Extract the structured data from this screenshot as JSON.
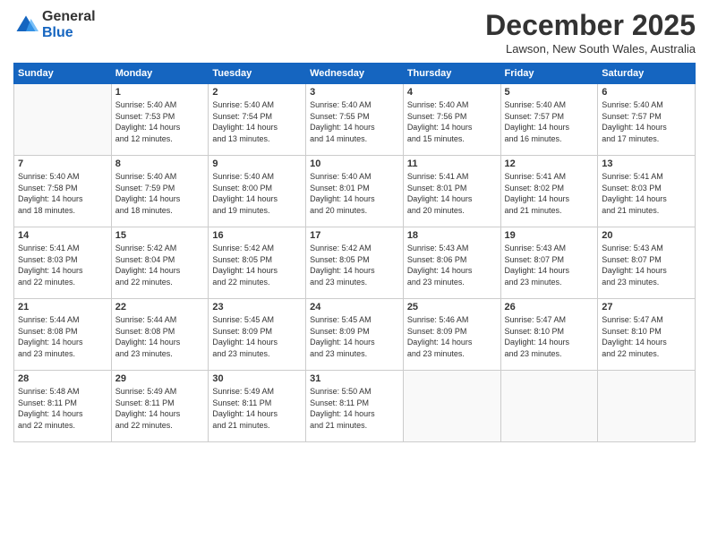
{
  "logo": {
    "general": "General",
    "blue": "Blue"
  },
  "title": "December 2025",
  "subtitle": "Lawson, New South Wales, Australia",
  "weekdays": [
    "Sunday",
    "Monday",
    "Tuesday",
    "Wednesday",
    "Thursday",
    "Friday",
    "Saturday"
  ],
  "weeks": [
    [
      {
        "day": "",
        "info": ""
      },
      {
        "day": "1",
        "info": "Sunrise: 5:40 AM\nSunset: 7:53 PM\nDaylight: 14 hours\nand 12 minutes."
      },
      {
        "day": "2",
        "info": "Sunrise: 5:40 AM\nSunset: 7:54 PM\nDaylight: 14 hours\nand 13 minutes."
      },
      {
        "day": "3",
        "info": "Sunrise: 5:40 AM\nSunset: 7:55 PM\nDaylight: 14 hours\nand 14 minutes."
      },
      {
        "day": "4",
        "info": "Sunrise: 5:40 AM\nSunset: 7:56 PM\nDaylight: 14 hours\nand 15 minutes."
      },
      {
        "day": "5",
        "info": "Sunrise: 5:40 AM\nSunset: 7:57 PM\nDaylight: 14 hours\nand 16 minutes."
      },
      {
        "day": "6",
        "info": "Sunrise: 5:40 AM\nSunset: 7:57 PM\nDaylight: 14 hours\nand 17 minutes."
      }
    ],
    [
      {
        "day": "7",
        "info": "Sunrise: 5:40 AM\nSunset: 7:58 PM\nDaylight: 14 hours\nand 18 minutes."
      },
      {
        "day": "8",
        "info": "Sunrise: 5:40 AM\nSunset: 7:59 PM\nDaylight: 14 hours\nand 18 minutes."
      },
      {
        "day": "9",
        "info": "Sunrise: 5:40 AM\nSunset: 8:00 PM\nDaylight: 14 hours\nand 19 minutes."
      },
      {
        "day": "10",
        "info": "Sunrise: 5:40 AM\nSunset: 8:01 PM\nDaylight: 14 hours\nand 20 minutes."
      },
      {
        "day": "11",
        "info": "Sunrise: 5:41 AM\nSunset: 8:01 PM\nDaylight: 14 hours\nand 20 minutes."
      },
      {
        "day": "12",
        "info": "Sunrise: 5:41 AM\nSunset: 8:02 PM\nDaylight: 14 hours\nand 21 minutes."
      },
      {
        "day": "13",
        "info": "Sunrise: 5:41 AM\nSunset: 8:03 PM\nDaylight: 14 hours\nand 21 minutes."
      }
    ],
    [
      {
        "day": "14",
        "info": "Sunrise: 5:41 AM\nSunset: 8:03 PM\nDaylight: 14 hours\nand 22 minutes."
      },
      {
        "day": "15",
        "info": "Sunrise: 5:42 AM\nSunset: 8:04 PM\nDaylight: 14 hours\nand 22 minutes."
      },
      {
        "day": "16",
        "info": "Sunrise: 5:42 AM\nSunset: 8:05 PM\nDaylight: 14 hours\nand 22 minutes."
      },
      {
        "day": "17",
        "info": "Sunrise: 5:42 AM\nSunset: 8:05 PM\nDaylight: 14 hours\nand 23 minutes."
      },
      {
        "day": "18",
        "info": "Sunrise: 5:43 AM\nSunset: 8:06 PM\nDaylight: 14 hours\nand 23 minutes."
      },
      {
        "day": "19",
        "info": "Sunrise: 5:43 AM\nSunset: 8:07 PM\nDaylight: 14 hours\nand 23 minutes."
      },
      {
        "day": "20",
        "info": "Sunrise: 5:43 AM\nSunset: 8:07 PM\nDaylight: 14 hours\nand 23 minutes."
      }
    ],
    [
      {
        "day": "21",
        "info": "Sunrise: 5:44 AM\nSunset: 8:08 PM\nDaylight: 14 hours\nand 23 minutes."
      },
      {
        "day": "22",
        "info": "Sunrise: 5:44 AM\nSunset: 8:08 PM\nDaylight: 14 hours\nand 23 minutes."
      },
      {
        "day": "23",
        "info": "Sunrise: 5:45 AM\nSunset: 8:09 PM\nDaylight: 14 hours\nand 23 minutes."
      },
      {
        "day": "24",
        "info": "Sunrise: 5:45 AM\nSunset: 8:09 PM\nDaylight: 14 hours\nand 23 minutes."
      },
      {
        "day": "25",
        "info": "Sunrise: 5:46 AM\nSunset: 8:09 PM\nDaylight: 14 hours\nand 23 minutes."
      },
      {
        "day": "26",
        "info": "Sunrise: 5:47 AM\nSunset: 8:10 PM\nDaylight: 14 hours\nand 23 minutes."
      },
      {
        "day": "27",
        "info": "Sunrise: 5:47 AM\nSunset: 8:10 PM\nDaylight: 14 hours\nand 22 minutes."
      }
    ],
    [
      {
        "day": "28",
        "info": "Sunrise: 5:48 AM\nSunset: 8:11 PM\nDaylight: 14 hours\nand 22 minutes."
      },
      {
        "day": "29",
        "info": "Sunrise: 5:49 AM\nSunset: 8:11 PM\nDaylight: 14 hours\nand 22 minutes."
      },
      {
        "day": "30",
        "info": "Sunrise: 5:49 AM\nSunset: 8:11 PM\nDaylight: 14 hours\nand 21 minutes."
      },
      {
        "day": "31",
        "info": "Sunrise: 5:50 AM\nSunset: 8:11 PM\nDaylight: 14 hours\nand 21 minutes."
      },
      {
        "day": "",
        "info": ""
      },
      {
        "day": "",
        "info": ""
      },
      {
        "day": "",
        "info": ""
      }
    ]
  ]
}
